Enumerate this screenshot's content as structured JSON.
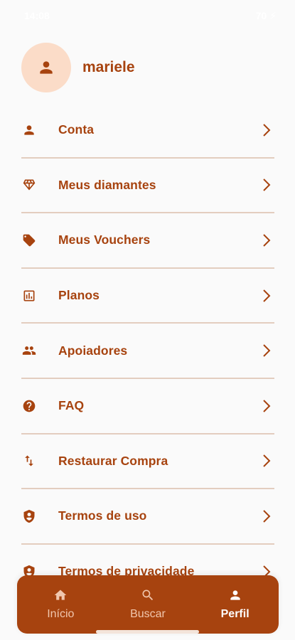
{
  "status_bar": {
    "time": "14:08",
    "battery": "70 ⚡"
  },
  "profile": {
    "username": "mariele",
    "avatar_icon": "person-icon"
  },
  "menu": {
    "items": [
      {
        "label": "Conta",
        "icon": "person-icon"
      },
      {
        "label": "Meus diamantes",
        "icon": "diamond-icon"
      },
      {
        "label": "Meus Vouchers",
        "icon": "tag-icon"
      },
      {
        "label": "Planos",
        "icon": "chart-icon"
      },
      {
        "label": "Apoiadores",
        "icon": "group-icon"
      },
      {
        "label": "FAQ",
        "icon": "help-icon"
      },
      {
        "label": "Restaurar Compra",
        "icon": "swap-icon"
      },
      {
        "label": "Termos de uso",
        "icon": "shield-icon"
      },
      {
        "label": "Termos de privacidade",
        "icon": "shield-icon"
      }
    ]
  },
  "bottom_nav": {
    "items": [
      {
        "label": "Início",
        "icon": "home-icon"
      },
      {
        "label": "Buscar",
        "icon": "search-icon"
      },
      {
        "label": "Perfil",
        "icon": "person-icon"
      }
    ],
    "active": "Perfil"
  },
  "colors": {
    "accent": "#a7430f",
    "avatar_bg": "#fbdcc8",
    "divider": "#e3cdbf",
    "background": "#fafafa",
    "nav_inactive": "#f1c7ae"
  }
}
